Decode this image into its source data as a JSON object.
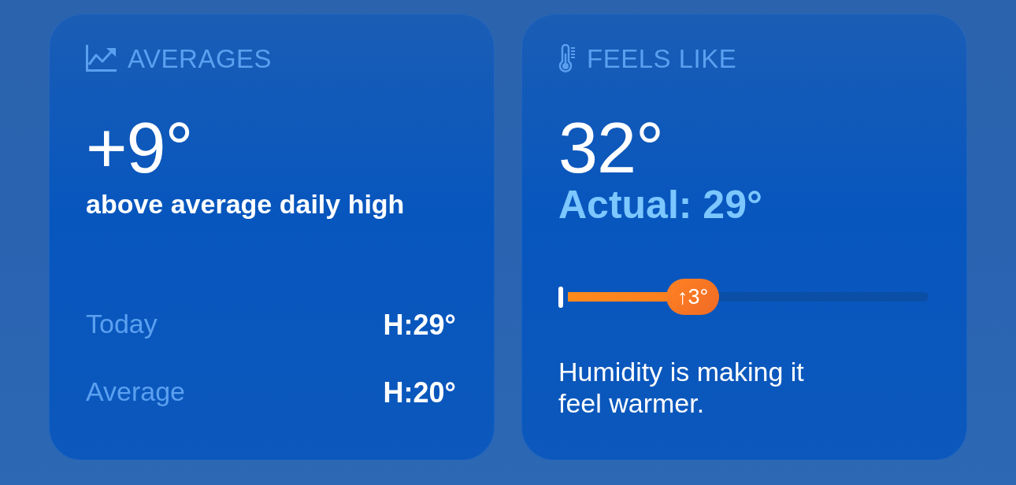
{
  "cards": [
    {
      "kind": "averages",
      "title": "AVERAGES",
      "value": "+9°",
      "caption": "above average daily high",
      "rows": [
        {
          "label": "Today",
          "value": "H:29°"
        },
        {
          "label": "Average",
          "value": "H:20°"
        }
      ]
    },
    {
      "kind": "feels_like",
      "title": "FEELS LIKE",
      "value": "32°",
      "actual": "Actual: 29°",
      "meter": {
        "level": 0.42,
        "label": "↑3°"
      },
      "description": "Humidity is making it feel warmer."
    }
  ]
}
